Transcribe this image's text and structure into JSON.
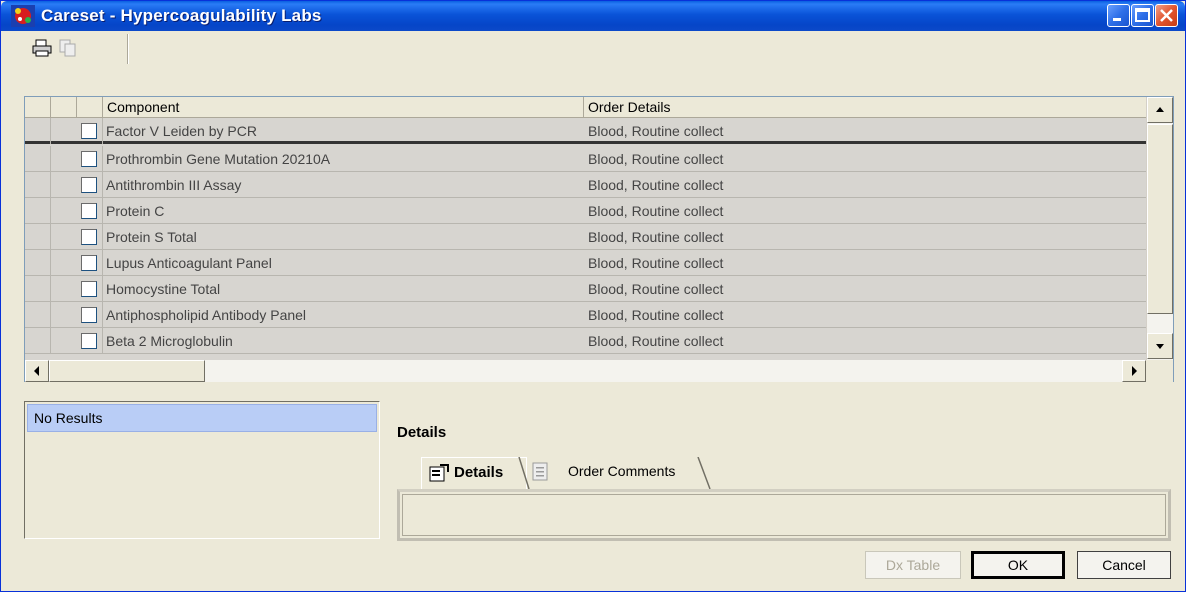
{
  "window": {
    "title": "Careset - Hypercoagulability Labs",
    "icon": "careset-app-icon",
    "controls": [
      "minimize-icon",
      "maximize-icon",
      "close-icon"
    ]
  },
  "toolbar": {
    "icons": [
      "print-icon",
      "copy-icon"
    ]
  },
  "grid": {
    "columns": [
      "Component",
      "Order Details"
    ],
    "rows": [
      {
        "component": "Factor V Leiden by PCR",
        "details": "Blood, Routine collect",
        "checked": false
      },
      {
        "component": "Prothrombin Gene Mutation 20210A",
        "details": "Blood, Routine collect",
        "checked": false
      },
      {
        "component": "Antithrombin III Assay",
        "details": "Blood, Routine collect",
        "checked": false
      },
      {
        "component": "Protein C",
        "details": "Blood, Routine collect",
        "checked": false
      },
      {
        "component": "Protein S Total",
        "details": "Blood, Routine collect",
        "checked": false
      },
      {
        "component": "Lupus Anticoagulant Panel",
        "details": "Blood, Routine collect",
        "checked": false
      },
      {
        "component": "Homocystine Total",
        "details": "Blood, Routine collect",
        "checked": false
      },
      {
        "component": "Antiphospholipid Antibody Panel",
        "details": "Blood, Routine collect",
        "checked": false
      },
      {
        "component": "Beta 2 Microglobulin",
        "details": "Blood, Routine collect",
        "checked": false
      }
    ]
  },
  "results": {
    "items": [
      "No Results"
    ]
  },
  "details": {
    "label": "Details",
    "tabs": [
      {
        "label": "Details",
        "icon": "details-icon",
        "active": true
      },
      {
        "label": "Order Comments",
        "icon": "comments-icon",
        "active": false
      }
    ]
  },
  "buttons": {
    "dx_table": "Dx Table",
    "ok": "OK",
    "cancel": "Cancel"
  }
}
